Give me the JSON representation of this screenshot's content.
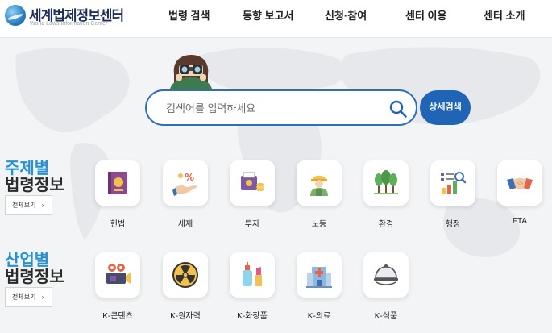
{
  "header": {
    "logo_title": "세계법제정보센터",
    "logo_subtitle": "World Laws Information Center",
    "nav": [
      "법령 검색",
      "동향 보고서",
      "신청·참여",
      "센터 이용",
      "센터 소개"
    ]
  },
  "search": {
    "placeholder": "검색어를 입력하세요",
    "value": "",
    "advanced_label": "상세검색"
  },
  "sections": [
    {
      "title_line1": "주제별",
      "title_line2": "법령정보",
      "view_all": "전체보기",
      "items": [
        {
          "label": "헌법",
          "icon": "constitution-icon"
        },
        {
          "label": "세제",
          "icon": "tax-icon"
        },
        {
          "label": "투자",
          "icon": "investment-icon"
        },
        {
          "label": "노동",
          "icon": "labor-icon"
        },
        {
          "label": "환경",
          "icon": "environment-icon"
        },
        {
          "label": "행정",
          "icon": "administration-icon"
        },
        {
          "label": "FTA",
          "icon": "fta-icon"
        }
      ]
    },
    {
      "title_line1": "산업별",
      "title_line2": "법령정보",
      "view_all": "전체보기",
      "items": [
        {
          "label": "K-콘텐츠",
          "icon": "content-camera-icon"
        },
        {
          "label": "K-원자력",
          "icon": "nuclear-icon"
        },
        {
          "label": "K-화장품",
          "icon": "cosmetics-icon"
        },
        {
          "label": "K-의료",
          "icon": "hospital-icon"
        },
        {
          "label": "K-식품",
          "icon": "food-cloche-icon"
        }
      ]
    }
  ],
  "colors": {
    "accent": "#1f64b5",
    "section_blue": "#2493d6",
    "search_border": "#2f6fb5"
  }
}
